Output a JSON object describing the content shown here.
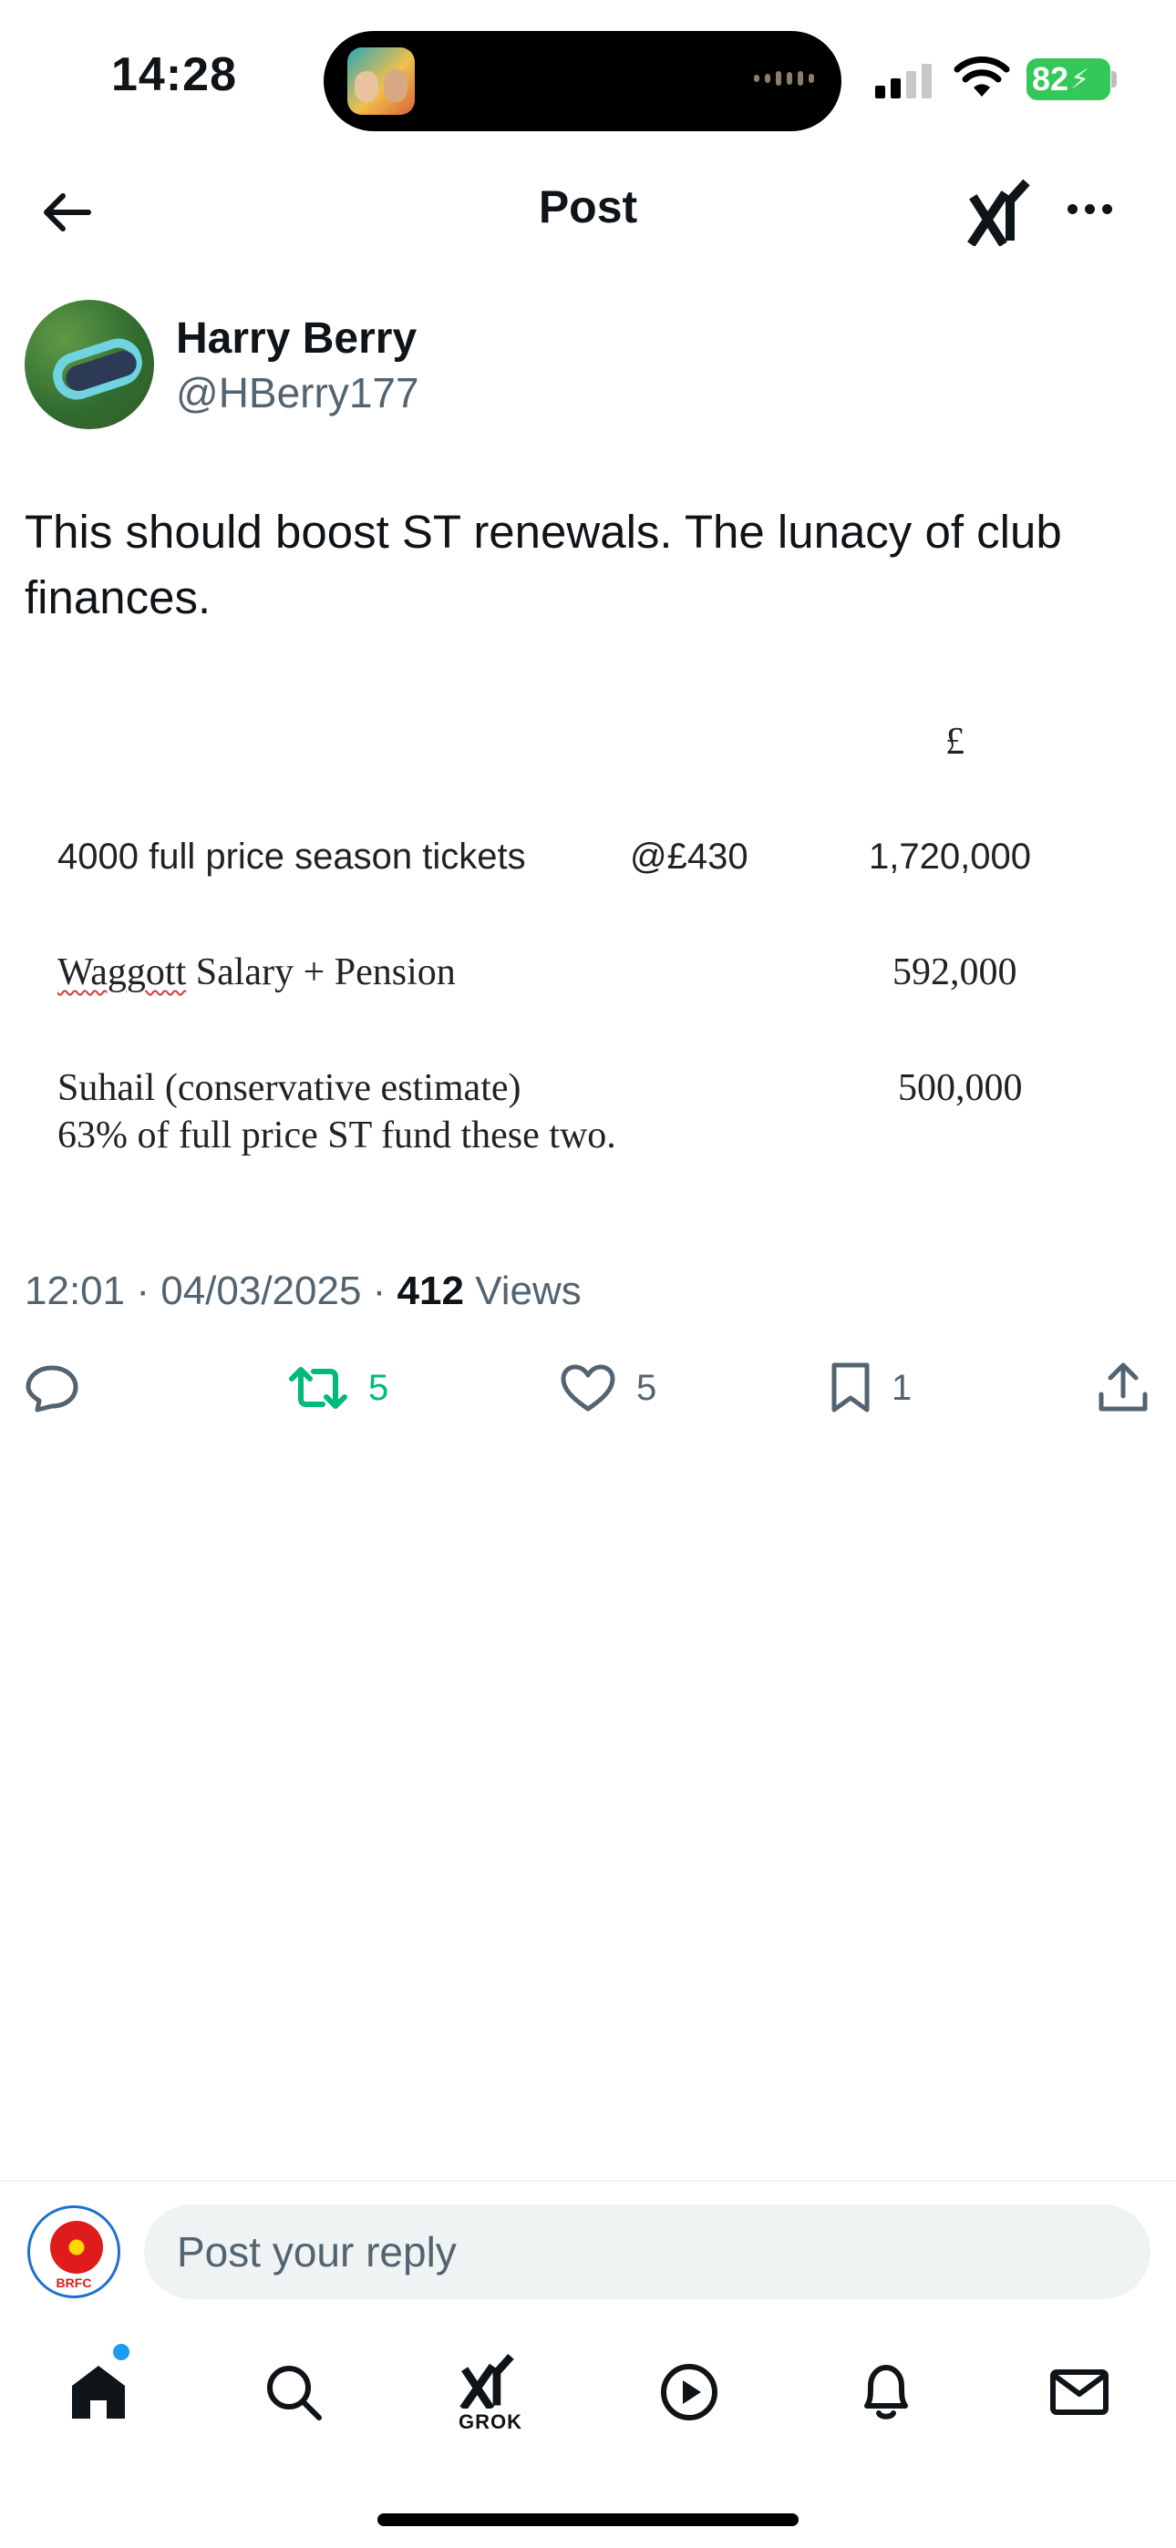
{
  "status_bar": {
    "time": "14:28",
    "battery": "82"
  },
  "header": {
    "title": "Post"
  },
  "author": {
    "name": "Harry Berry",
    "handle": "@HBerry177"
  },
  "post": {
    "text": "This should boost ST renewals. The lunacy of club finances.",
    "image": {
      "currency_header": "£",
      "rows": [
        {
          "label": "4000 full price season tickets",
          "rate": "@£430",
          "amount": "1,720,000"
        },
        {
          "label_prefix": "Waggott",
          "label_suffix": " Salary + Pension",
          "amount": "592,000"
        },
        {
          "label": "Suhail (conservative estimate)",
          "amount": "500,000"
        }
      ],
      "note": "63% of full price ST fund these two."
    },
    "meta": {
      "time": "12:01",
      "date": "04/03/2025",
      "separator": " · ",
      "views_count": "412",
      "views_label": "Views"
    },
    "actions": {
      "reposts": "5",
      "likes": "5",
      "bookmarks": "1"
    }
  },
  "reply": {
    "placeholder": "Post your reply",
    "avatar_text": "BRFC"
  },
  "tab_bar": {
    "grok_label": "GROK"
  },
  "colors": {
    "text": "#0f1419",
    "secondary": "#536471",
    "repost_green": "#00ba7c",
    "accent_blue": "#1d9bf0",
    "battery_green": "#34c759"
  }
}
